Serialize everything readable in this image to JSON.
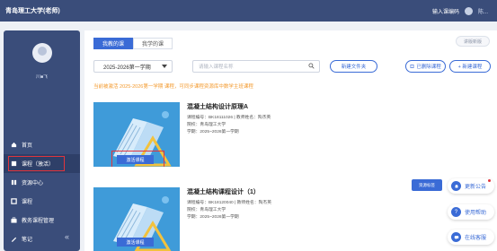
{
  "app": {
    "title": "青岛理工大学(老师)"
  },
  "topbar": {
    "enter_label": "输入课编码",
    "username": "陈..."
  },
  "sidebar": {
    "username": "川■飞",
    "items": [
      {
        "label": "首页",
        "icon": "home-icon"
      },
      {
        "label": "课程（激活）",
        "icon": "book-icon"
      },
      {
        "label": "资源中心",
        "icon": "resource-icon"
      },
      {
        "label": "课程",
        "icon": "course-icon"
      },
      {
        "label": "教务课程管理",
        "icon": "briefcase-icon"
      },
      {
        "label": "笔记",
        "icon": "note-icon"
      }
    ],
    "collapse_symbol": "«"
  },
  "tabs": [
    {
      "label": "我教的课"
    },
    {
      "label": "我学的课"
    }
  ],
  "top_right_button": "讲版新版",
  "filters": {
    "semester": "2025-2026第一学期",
    "search_placeholder": "请输入课程名称",
    "new_folder": "新建文件夹",
    "deleted_courses": "已删除课程",
    "create_course": "+ 新建课程"
  },
  "notice": "当前被激活 2025-2026第一学期 课程，可同步课程资源库中数学主班课程",
  "courses": [
    {
      "title": "混凝土结构设计原理A",
      "code": "课程编号：BK18111026 | 教师姓名：陶杰英",
      "school": "院校：青岛理工大学",
      "term": "学期：2025~2026第一学期",
      "badge": "激活课程"
    },
    {
      "title": "混凝土结构课程设计（1）",
      "code": "课程编号：BK18120040 | 教师姓名：陶杰英",
      "school": "院校：青岛理工大学",
      "term": "学期：2025~2026第一学期",
      "badge": "激活课程"
    }
  ],
  "float": {
    "tag": "资源标签",
    "help": [
      {
        "label": "更新公告",
        "icon": "bell-icon"
      },
      {
        "label": "使用帮助",
        "icon": "help-icon"
      },
      {
        "label": "在线客服",
        "icon": "chat-icon"
      }
    ]
  },
  "colors": {
    "nav_bg": "#3a4d7a",
    "accent": "#3a6bd6",
    "highlight": "#e0353d",
    "notice": "#f39a2e"
  }
}
